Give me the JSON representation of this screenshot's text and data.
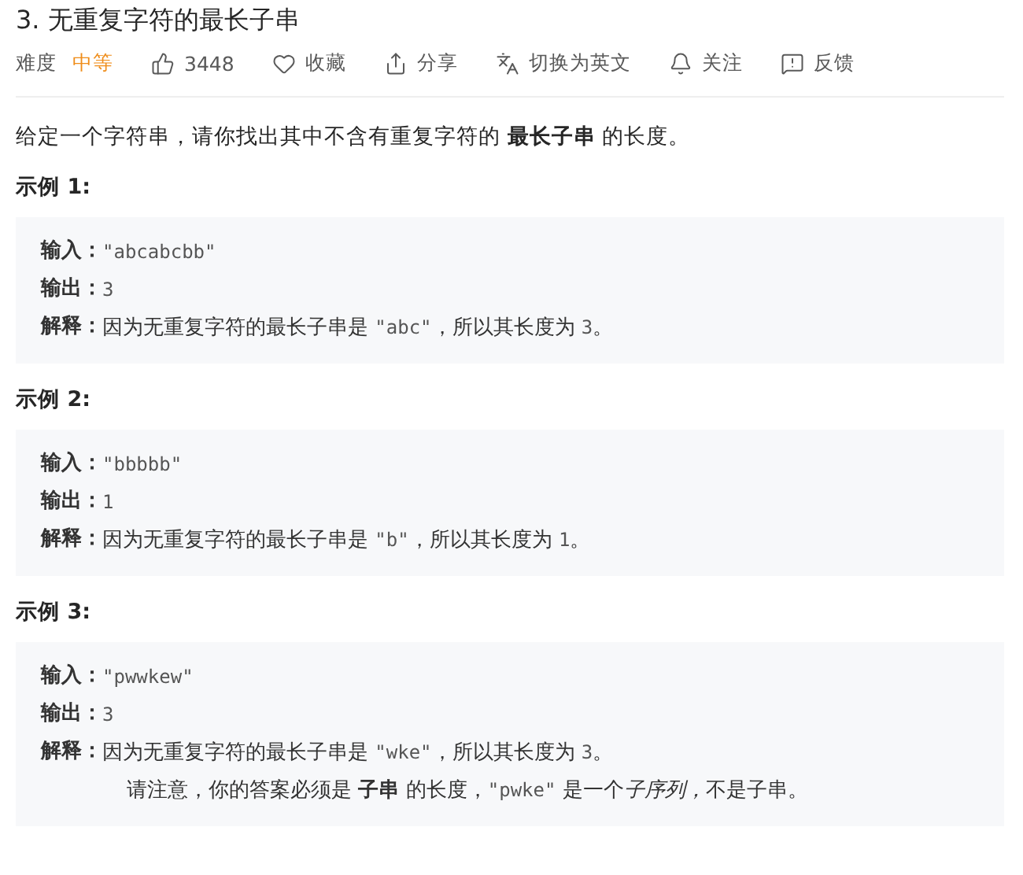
{
  "title": "3. 无重复字符的最长子串",
  "meta": [
    {
      "kind": "difficulty",
      "label": "难度",
      "value": "中等"
    },
    {
      "kind": "likes",
      "label": "3448"
    },
    {
      "kind": "favorite",
      "label": "收藏"
    },
    {
      "kind": "share",
      "label": "分享"
    },
    {
      "kind": "translate",
      "label": "切换为英文"
    },
    {
      "kind": "follow",
      "label": "关注"
    },
    {
      "kind": "feedback",
      "label": "反馈"
    }
  ],
  "description": "给定一个字符串，请你找出其中不含有重复字符的 **最长子串** 的长度。",
  "examples": [
    {
      "title": "示例 1:",
      "lines": [
        {
          "label": "输入：",
          "segments": [
            {
              "kind": "code",
              "text": "\"abcabcbb\""
            }
          ]
        },
        {
          "label": "输出：",
          "segments": [
            {
              "kind": "code",
              "text": "3"
            }
          ]
        },
        {
          "label": "解释：",
          "segments": [
            {
              "kind": "text",
              "text": "因为无重复字符的最长子串是 "
            },
            {
              "kind": "code",
              "text": "\"abc\""
            },
            {
              "kind": "text",
              "text": "，所以其长度为 "
            },
            {
              "kind": "code",
              "text": "3"
            },
            {
              "kind": "text",
              "text": "。"
            }
          ]
        }
      ]
    },
    {
      "title": "示例 2:",
      "lines": [
        {
          "label": "输入：",
          "segments": [
            {
              "kind": "code",
              "text": "\"bbbbb\""
            }
          ]
        },
        {
          "label": "输出：",
          "segments": [
            {
              "kind": "code",
              "text": "1"
            }
          ]
        },
        {
          "label": "解释：",
          "segments": [
            {
              "kind": "text",
              "text": "因为无重复字符的最长子串是 "
            },
            {
              "kind": "code",
              "text": "\"b\""
            },
            {
              "kind": "text",
              "text": "，所以其长度为 "
            },
            {
              "kind": "code",
              "text": "1"
            },
            {
              "kind": "text",
              "text": "。"
            }
          ]
        }
      ]
    },
    {
      "title": "示例 3:",
      "lines": [
        {
          "label": "输入：",
          "segments": [
            {
              "kind": "code",
              "text": "\"pwwkew\""
            }
          ]
        },
        {
          "label": "输出：",
          "segments": [
            {
              "kind": "code",
              "text": "3"
            }
          ]
        },
        {
          "label": "解释：",
          "segments": [
            {
              "kind": "text",
              "text": "因为无重复字符的最长子串是 "
            },
            {
              "kind": "code",
              "text": "\"wke\""
            },
            {
              "kind": "text",
              "text": "，所以其长度为 "
            },
            {
              "kind": "code",
              "text": "3"
            },
            {
              "kind": "text",
              "text": "。"
            }
          ]
        },
        {
          "segments": [
            {
              "kind": "text",
              "text": "请注意，你的答案必须是 "
            },
            {
              "kind": "bold",
              "text": "子串"
            },
            {
              "kind": "text",
              "text": " 的长度，"
            },
            {
              "kind": "code",
              "text": "\"pwke\""
            },
            {
              "kind": "text",
              "text": " 是一个"
            },
            {
              "kind": "italic",
              "text": "子序列，"
            },
            {
              "kind": "text",
              "text": "不是子串。"
            }
          ]
        }
      ]
    }
  ]
}
